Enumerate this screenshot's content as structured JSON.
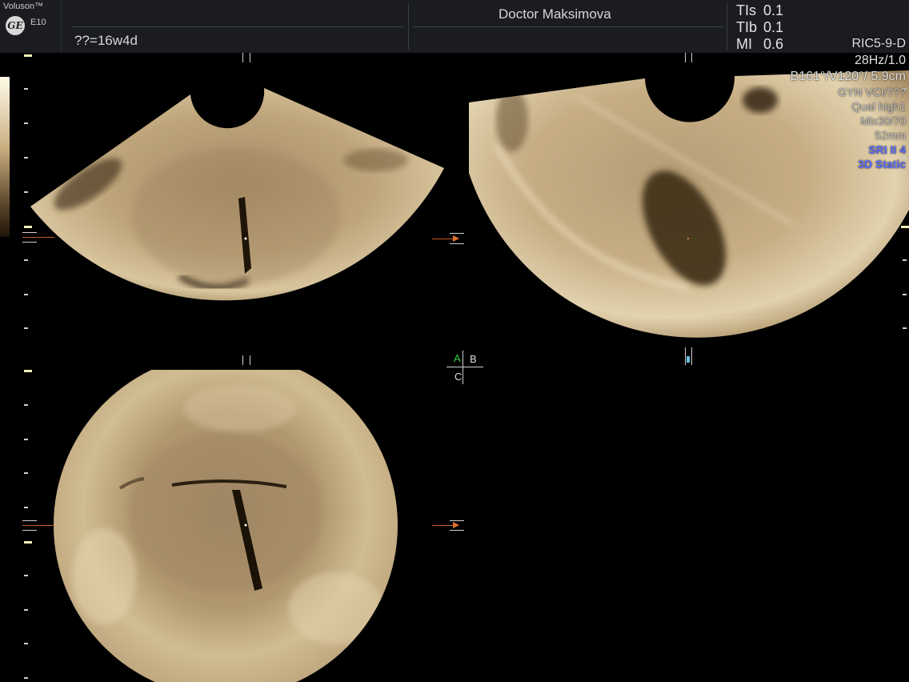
{
  "header": {
    "brand": "Voluson™",
    "model": "E10",
    "logo_icon": "ge-logo-icon",
    "gestational_age": "??=16w4d",
    "operator": "Doctor Maksimova",
    "safety": [
      {
        "label": "TIs",
        "value": "0.1"
      },
      {
        "label": "TIb",
        "value": "0.1"
      },
      {
        "label": "MI",
        "value": "0.6"
      }
    ]
  },
  "info_panel": {
    "probe": "RIC5-9-D",
    "frame_rate": "28Hz/1.0",
    "angles": "B161°/V120°/ 5.9cm",
    "preset": "GYN VCI/???",
    "quality": "Qual high1",
    "mix": "Mix30/70",
    "thickness": "52mm",
    "sri": "SRI II 4",
    "mode": "3D Static"
  },
  "mpr_labels": {
    "a": "A",
    "b": "B",
    "c": "C"
  },
  "colors": {
    "header_bg": "#1a1c20",
    "scan_tone": "#c8ad82",
    "marker": "#e07030",
    "label_a": "#33cc44",
    "mode_text": "#5b6dff"
  }
}
